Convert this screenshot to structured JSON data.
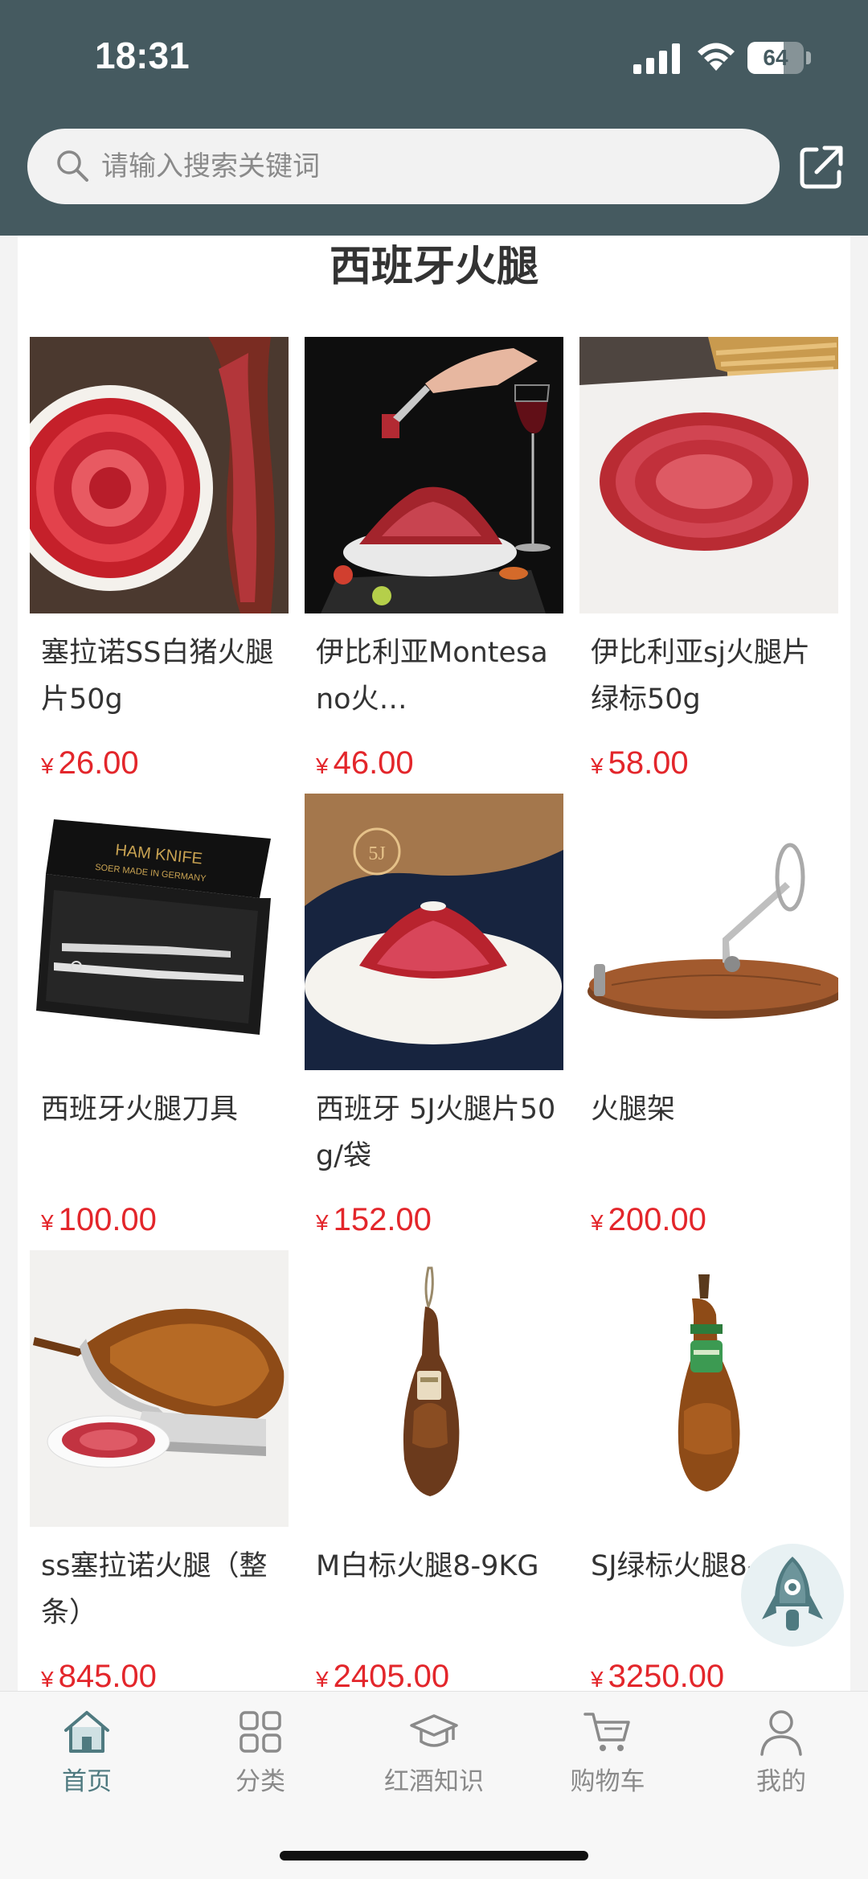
{
  "status_bar": {
    "time": "18:31",
    "battery": "64",
    "battery_level": 0.64
  },
  "search": {
    "placeholder": "请输入搜索关键词"
  },
  "section": {
    "title": "西班牙火腿"
  },
  "products": [
    {
      "name": "塞拉诺SS白猪火腿片50g",
      "currency": "¥",
      "price": "26.00"
    },
    {
      "name": "伊比利亚Montesano火…",
      "currency": "¥",
      "price": "46.00"
    },
    {
      "name": "伊比利亚sj火腿片绿标50g",
      "currency": "¥",
      "price": "58.00"
    },
    {
      "name": "西班牙火腿刀具",
      "currency": "¥",
      "price": "100.00"
    },
    {
      "name": "西班牙 5J火腿片50g/袋",
      "currency": "¥",
      "price": "152.00"
    },
    {
      "name": "火腿架",
      "currency": "¥",
      "price": "200.00"
    },
    {
      "name": "ss塞拉诺火腿（整条）",
      "currency": "¥",
      "price": "845.00"
    },
    {
      "name": "M白标火腿8-9KG",
      "currency": "¥",
      "price": "2405.00"
    },
    {
      "name": "SJ绿标火腿8-9KG",
      "currency": "¥",
      "price": "3250.00"
    }
  ],
  "product_images": {
    "knife_box_text_1": "HAM KNIFE",
    "knife_box_text_2": "SOER  MADE IN GERMANY",
    "plate_logo": "5J"
  },
  "tabs": [
    {
      "label": "首页",
      "icon": "home-icon",
      "active": true
    },
    {
      "label": "分类",
      "icon": "category-icon",
      "active": false
    },
    {
      "label": "红酒知识",
      "icon": "graduation-cap-icon",
      "active": false
    },
    {
      "label": "购物车",
      "icon": "cart-icon",
      "active": false
    },
    {
      "label": "我的",
      "icon": "user-icon",
      "active": false
    }
  ],
  "colors": {
    "header": "#455a60",
    "price": "#e3262b",
    "tab_active": "#4f7a80",
    "tab_inactive": "#8a8a8a"
  }
}
